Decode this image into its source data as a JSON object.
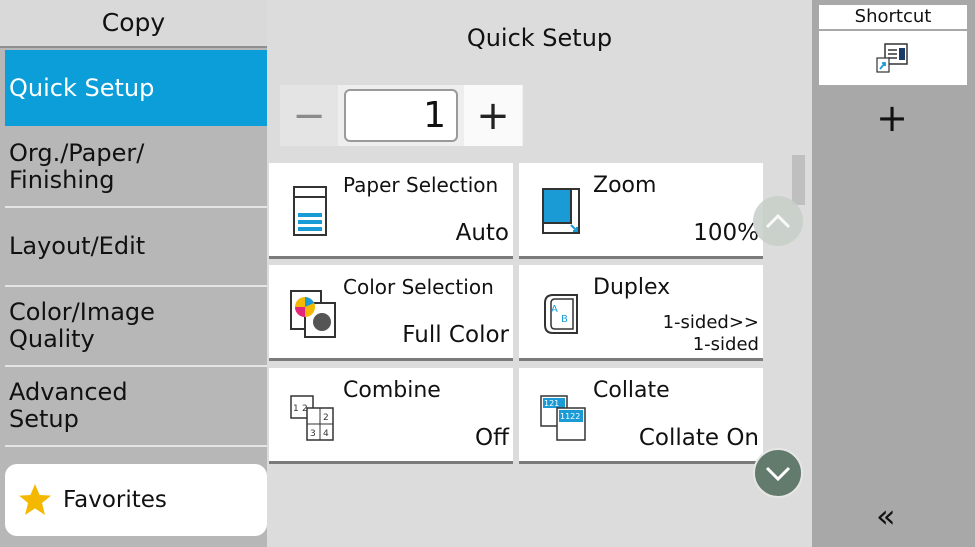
{
  "sidebar": {
    "title": "Copy",
    "items": [
      {
        "label": "Quick Setup",
        "lines": [
          "Quick Setup"
        ]
      },
      {
        "label": "Org./Paper/ Finishing",
        "lines": [
          "Org./Paper/",
          "Finishing"
        ]
      },
      {
        "label": "Layout/Edit",
        "lines": [
          "Layout/Edit"
        ]
      },
      {
        "label": "Color/Image Quality",
        "lines": [
          "Color/Image",
          "Quality"
        ]
      },
      {
        "label": "Advanced Setup",
        "lines": [
          "Advanced",
          "Setup"
        ]
      }
    ],
    "selected": "Quick Setup",
    "favorites_label": "Favorites"
  },
  "main": {
    "title": "Quick Setup",
    "copies": {
      "minus": "−",
      "value": "1",
      "plus": "+"
    },
    "tiles": [
      {
        "label": "Paper Selection",
        "value": "Auto",
        "icon": "paper-tray-icon"
      },
      {
        "label": "Zoom",
        "value": "100%",
        "icon": "zoom-icon"
      },
      {
        "label": "Color Selection",
        "value": "Full Color",
        "icon": "color-selection-icon"
      },
      {
        "label": "Duplex",
        "value_lines": [
          "1-sided>>",
          "1-sided"
        ],
        "icon": "duplex-icon"
      },
      {
        "label": "Combine",
        "value": "Off",
        "icon": "combine-icon"
      },
      {
        "label": "Collate",
        "value": "Collate On",
        "icon": "collate-icon"
      }
    ]
  },
  "right": {
    "shortcut_label": "Shortcut",
    "add_label": "+",
    "collapse_label": "«"
  },
  "colors": {
    "accent": "#0c9ed8",
    "star": "#f5b800",
    "scroll_button": "#637b6d"
  }
}
